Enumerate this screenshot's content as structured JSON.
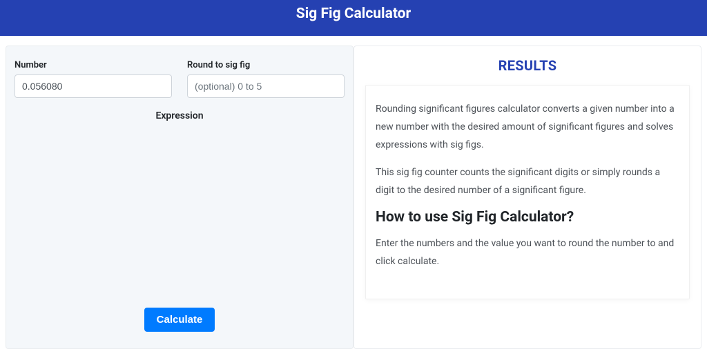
{
  "header": {
    "title": "Sig Fig Calculator"
  },
  "form": {
    "number_label": "Number",
    "number_value": "0.056080",
    "round_label": "Round to sig fig",
    "round_placeholder": "(optional) 0 to 5",
    "round_value": "",
    "expression_label": "Expression",
    "calculate_label": "Calculate"
  },
  "results": {
    "title": "RESULTS",
    "p1": "Rounding significant figures calculator converts a given number into a new number with the desired amount of significant figures and solves expressions with sig figs.",
    "p2": "This sig fig counter counts the significant digits or simply rounds a digit to the desired number of a significant figure.",
    "h2": "How to use Sig Fig Calculator?",
    "p3": "Enter the numbers and the value you want to round the number to and click calculate."
  }
}
